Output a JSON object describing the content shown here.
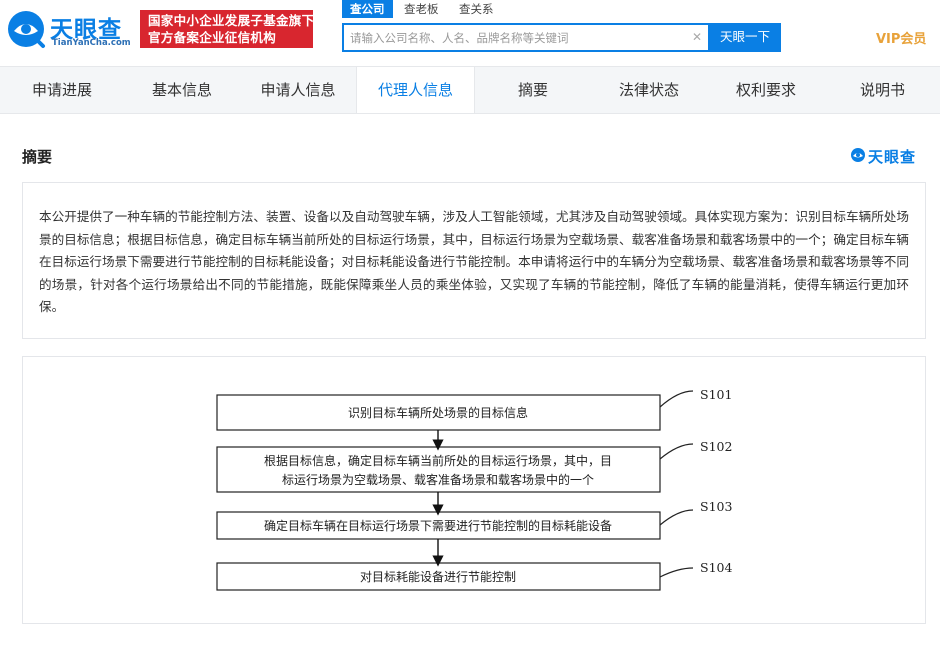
{
  "header": {
    "logo_text": "天眼查",
    "logo_sub": "TianYanCha.com",
    "badge_line1": "国家中小企业发展子基金旗下",
    "badge_line2": "官方备案企业征信机构",
    "search_tabs": [
      "查公司",
      "查老板",
      "查关系"
    ],
    "search_placeholder": "请输入公司名称、人名、品牌名称等关键词",
    "search_button": "天眼一下",
    "vip": "VIP会员"
  },
  "nav": {
    "tabs": [
      "申请进展",
      "基本信息",
      "申请人信息",
      "代理人信息",
      "摘要",
      "法律状态",
      "权利要求",
      "说明书"
    ],
    "active": "代理人信息"
  },
  "section": {
    "title": "摘要",
    "brand": "天眼查",
    "abstract": "本公开提供了一种车辆的节能控制方法、装置、设备以及自动驾驶车辆，涉及人工智能领域，尤其涉及自动驾驶领域。具体实现方案为：识别目标车辆所处场景的目标信息；根据目标信息，确定目标车辆当前所处的目标运行场景，其中，目标运行场景为空载场景、载客准备场景和载客场景中的一个；确定目标车辆在目标运行场景下需要进行节能控制的目标耗能设备；对目标耗能设备进行节能控制。本申请将运行中的车辆分为空载场景、载客准备场景和载客场景等不同的场景，针对各个运行场景给出不同的节能措施，既能保障乘坐人员的乘坐体验，又实现了车辆的节能控制，降低了车辆的能量消耗，使得车辆运行更加环保。"
  },
  "flowchart": {
    "steps": [
      {
        "label": "S101",
        "lines": [
          "识别目标车辆所处场景的目标信息"
        ]
      },
      {
        "label": "S102",
        "lines": [
          "根据目标信息，确定目标车辆当前所处的目标运行场景，其中，目",
          "标运行场景为空载场景、载客准备场景和载客场景中的一个"
        ]
      },
      {
        "label": "S103",
        "lines": [
          "确定目标车辆在目标运行场景下需要进行节能控制的目标耗能设备"
        ]
      },
      {
        "label": "S104",
        "lines": [
          "对目标耗能设备进行节能控制"
        ]
      }
    ]
  },
  "colors": {
    "brand_blue": "#0a7fe4",
    "badge_red": "#d8262f",
    "vip_gold": "#e8a23a"
  }
}
